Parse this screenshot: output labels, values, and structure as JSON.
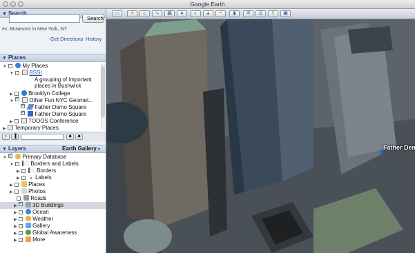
{
  "window": {
    "title": "Google Earth"
  },
  "search": {
    "header": "Search",
    "input_value": "",
    "button_label": "Search",
    "hint": "ex: Museums in New York, NY",
    "get_directions": "Get Directions",
    "history": "History"
  },
  "places": {
    "header": "Places",
    "items": [
      {
        "label": "My Places"
      },
      {
        "label": "BSSI"
      },
      {
        "label": "A grouping of important"
      },
      {
        "label": "places in Bushwick"
      },
      {
        "label": "Brooklyn College"
      },
      {
        "label": "Other Fun NYC Geomet..."
      },
      {
        "label": "Father Demo Square"
      },
      {
        "label": "Father Demo Square"
      },
      {
        "label": "TOOOS Conference"
      },
      {
        "label": "Temporary Places"
      }
    ]
  },
  "layers": {
    "header": "Layers",
    "gallery_button": "Earth Gallery",
    "gallery_chevron": "»",
    "items": [
      {
        "label": "Primary Database"
      },
      {
        "label": "Borders and Labels"
      },
      {
        "label": "Borders"
      },
      {
        "label": "Labels"
      },
      {
        "label": "Places"
      },
      {
        "label": "Photos"
      },
      {
        "label": "Roads"
      },
      {
        "label": "3D Buildings"
      },
      {
        "label": "Ocean"
      },
      {
        "label": "Weather"
      },
      {
        "label": "Gallery"
      },
      {
        "label": "Global Awareness"
      },
      {
        "label": "More"
      }
    ]
  },
  "map": {
    "placemark_label": "Father Demo"
  },
  "colors": {
    "accent": "#1d3b6a",
    "link": "#1f4f9a",
    "selected_row": "#d5d9df"
  }
}
